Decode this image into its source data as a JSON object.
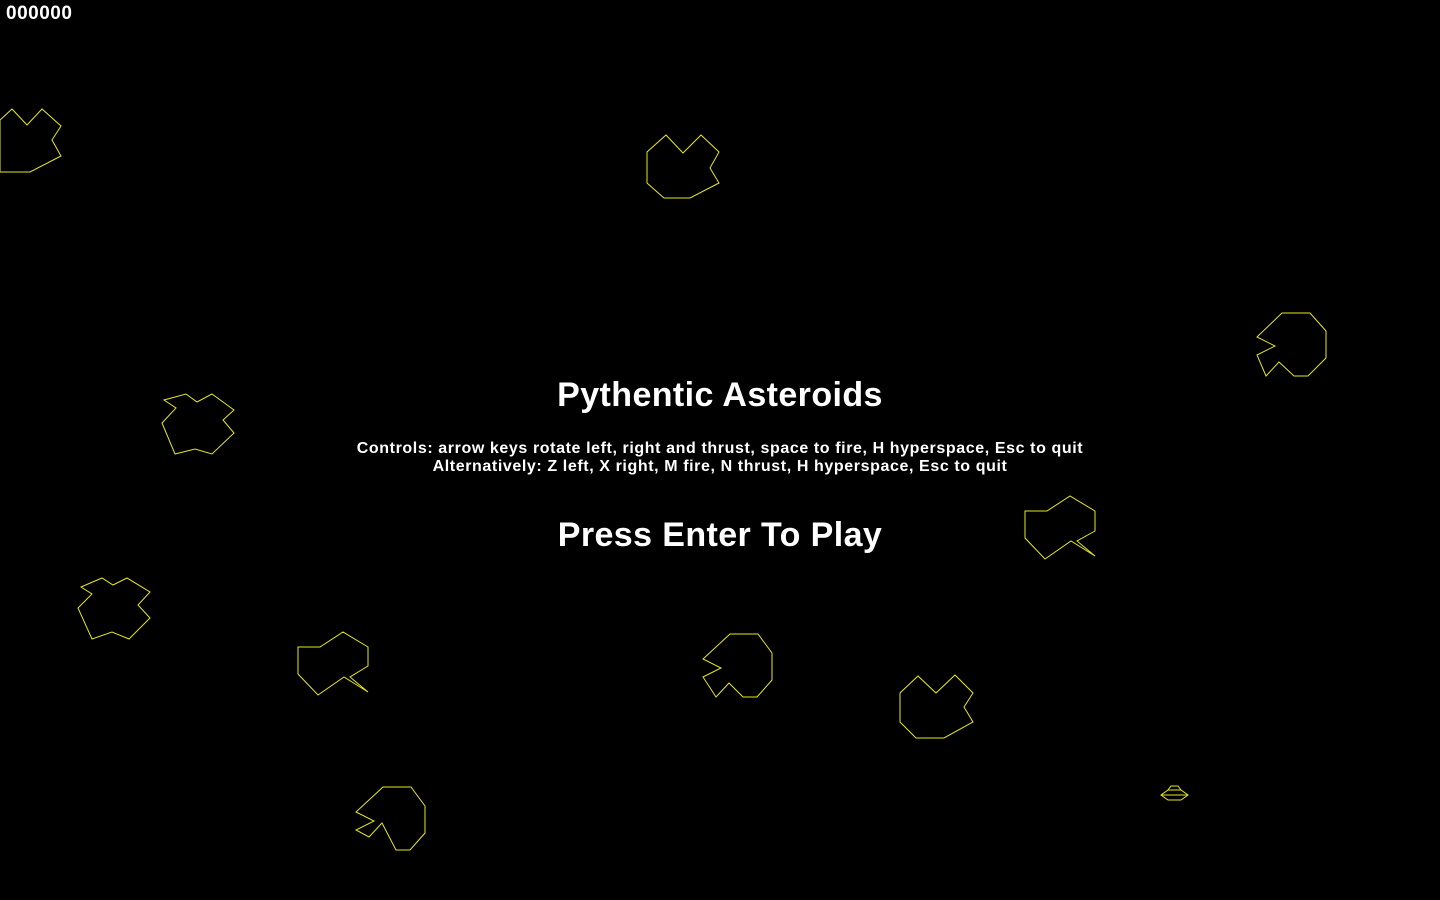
{
  "hud": {
    "score": "000000"
  },
  "title_screen": {
    "title": "Pythentic Asteroids",
    "controls_primary": "Controls: arrow keys rotate left, right and thrust, space to fire, H hyperspace, Esc to quit",
    "controls_alternative": "Alternatively: Z left, X right, M fire, N thrust, H hyperspace, Esc to quit",
    "prompt": "Press Enter To Play"
  },
  "colors": {
    "background": "#000000",
    "text": "#ffffff",
    "vector_stroke": "#e6e61e"
  }
}
